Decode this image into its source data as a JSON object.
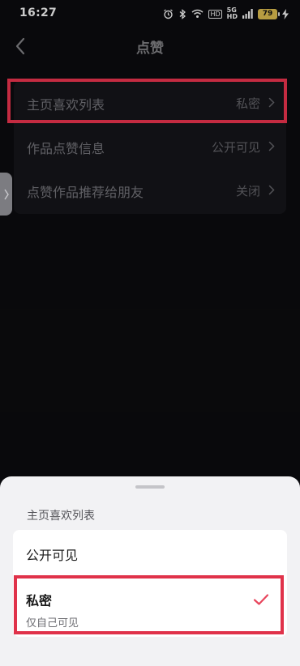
{
  "status_bar": {
    "time": "16:27",
    "hd_label": "HD",
    "network_top": "5G",
    "network_bottom": "HD",
    "battery_level": "79"
  },
  "nav": {
    "title": "点赞"
  },
  "settings": {
    "rows": [
      {
        "label": "主页喜欢列表",
        "value": "私密"
      },
      {
        "label": "作品点赞信息",
        "value": "公开可见"
      },
      {
        "label": "点赞作品推荐给朋友",
        "value": "关闭"
      }
    ]
  },
  "sheet": {
    "title": "主页喜欢列表",
    "options": {
      "public": {
        "label": "公开可见"
      },
      "private": {
        "label": "私密",
        "description": "仅自己可见"
      }
    }
  },
  "colors": {
    "highlight": "#e0324a",
    "check": "#e8455c",
    "background": "#0b0b0e"
  },
  "icons": {
    "back": "chevron-left-icon",
    "chevron": "chevron-right-icon",
    "check": "checkmark-icon",
    "handle": "side-handle-icon"
  }
}
